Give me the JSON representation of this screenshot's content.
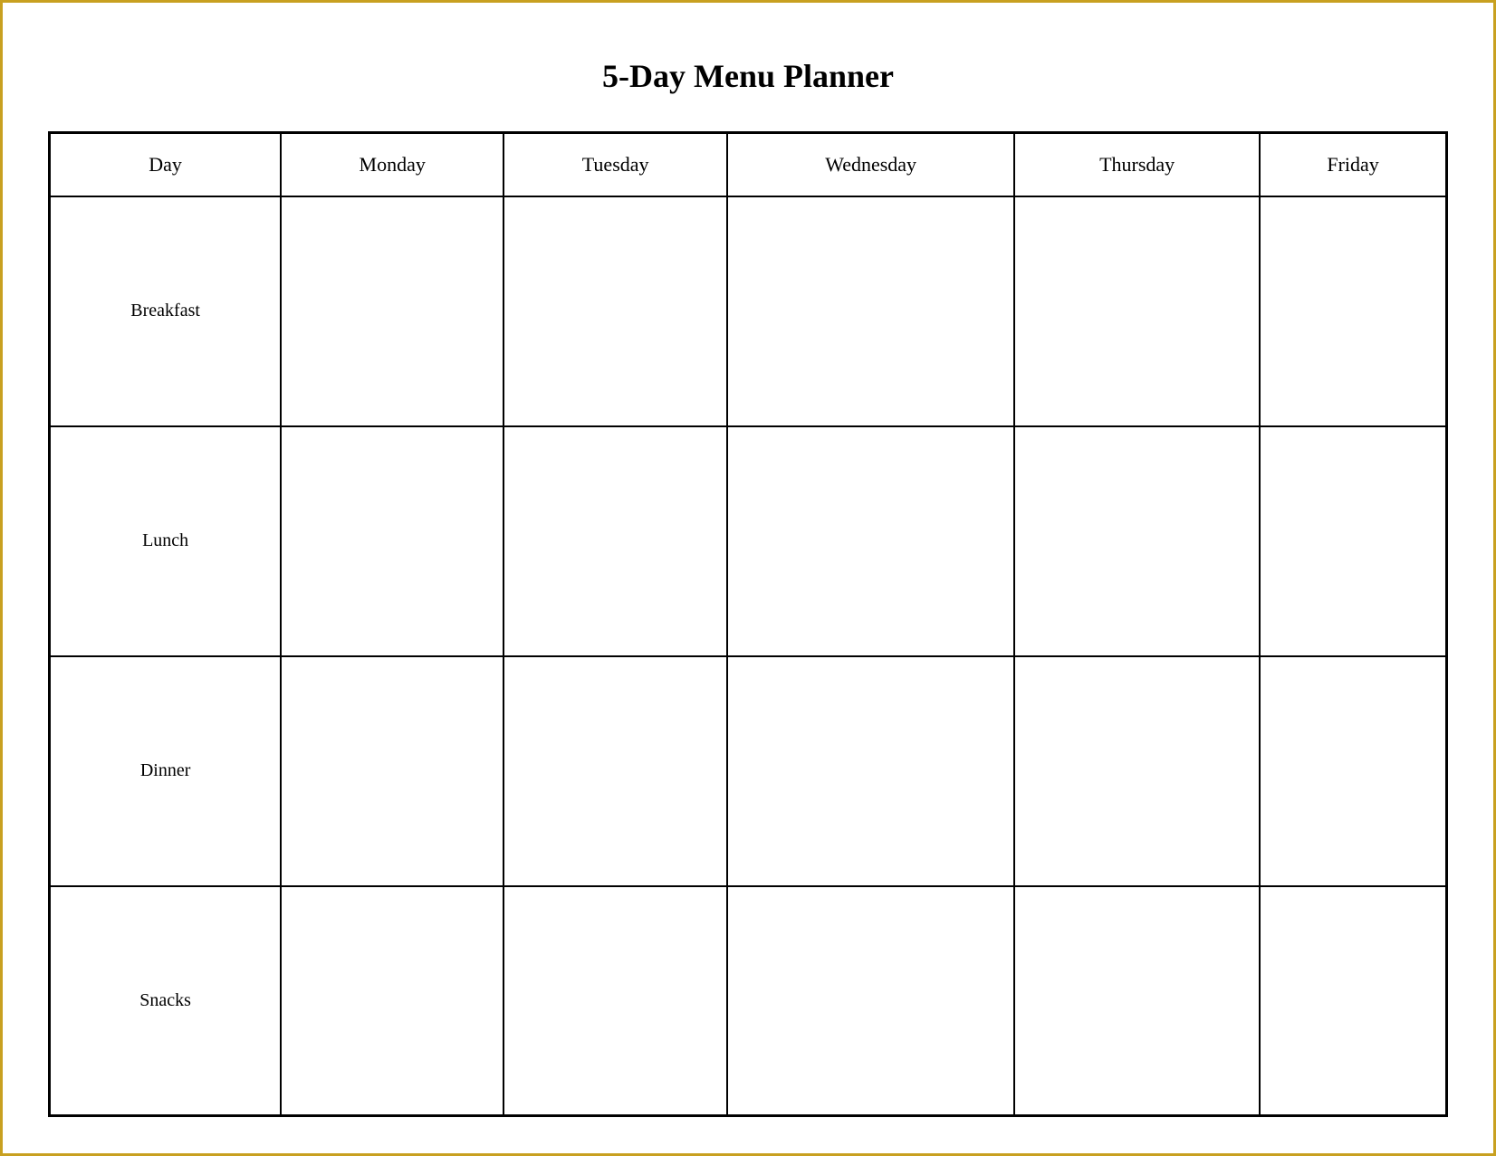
{
  "title": "5-Day Menu Planner",
  "table": {
    "headers": [
      {
        "id": "day",
        "label": "Day"
      },
      {
        "id": "monday",
        "label": "Monday"
      },
      {
        "id": "tuesday",
        "label": "Tuesday"
      },
      {
        "id": "wednesday",
        "label": "Wednesday"
      },
      {
        "id": "thursday",
        "label": "Thursday"
      },
      {
        "id": "friday",
        "label": "Friday"
      }
    ],
    "rows": [
      {
        "meal": "Breakfast",
        "monday": "",
        "tuesday": "",
        "wednesday": "",
        "thursday": "",
        "friday": ""
      },
      {
        "meal": "Lunch",
        "monday": "",
        "tuesday": "",
        "wednesday": "",
        "thursday": "",
        "friday": ""
      },
      {
        "meal": "Dinner",
        "monday": "",
        "tuesday": "",
        "wednesday": "",
        "thursday": "",
        "friday": ""
      },
      {
        "meal": "Snacks",
        "monday": "",
        "tuesday": "",
        "wednesday": "",
        "thursday": "",
        "friday": ""
      }
    ]
  }
}
